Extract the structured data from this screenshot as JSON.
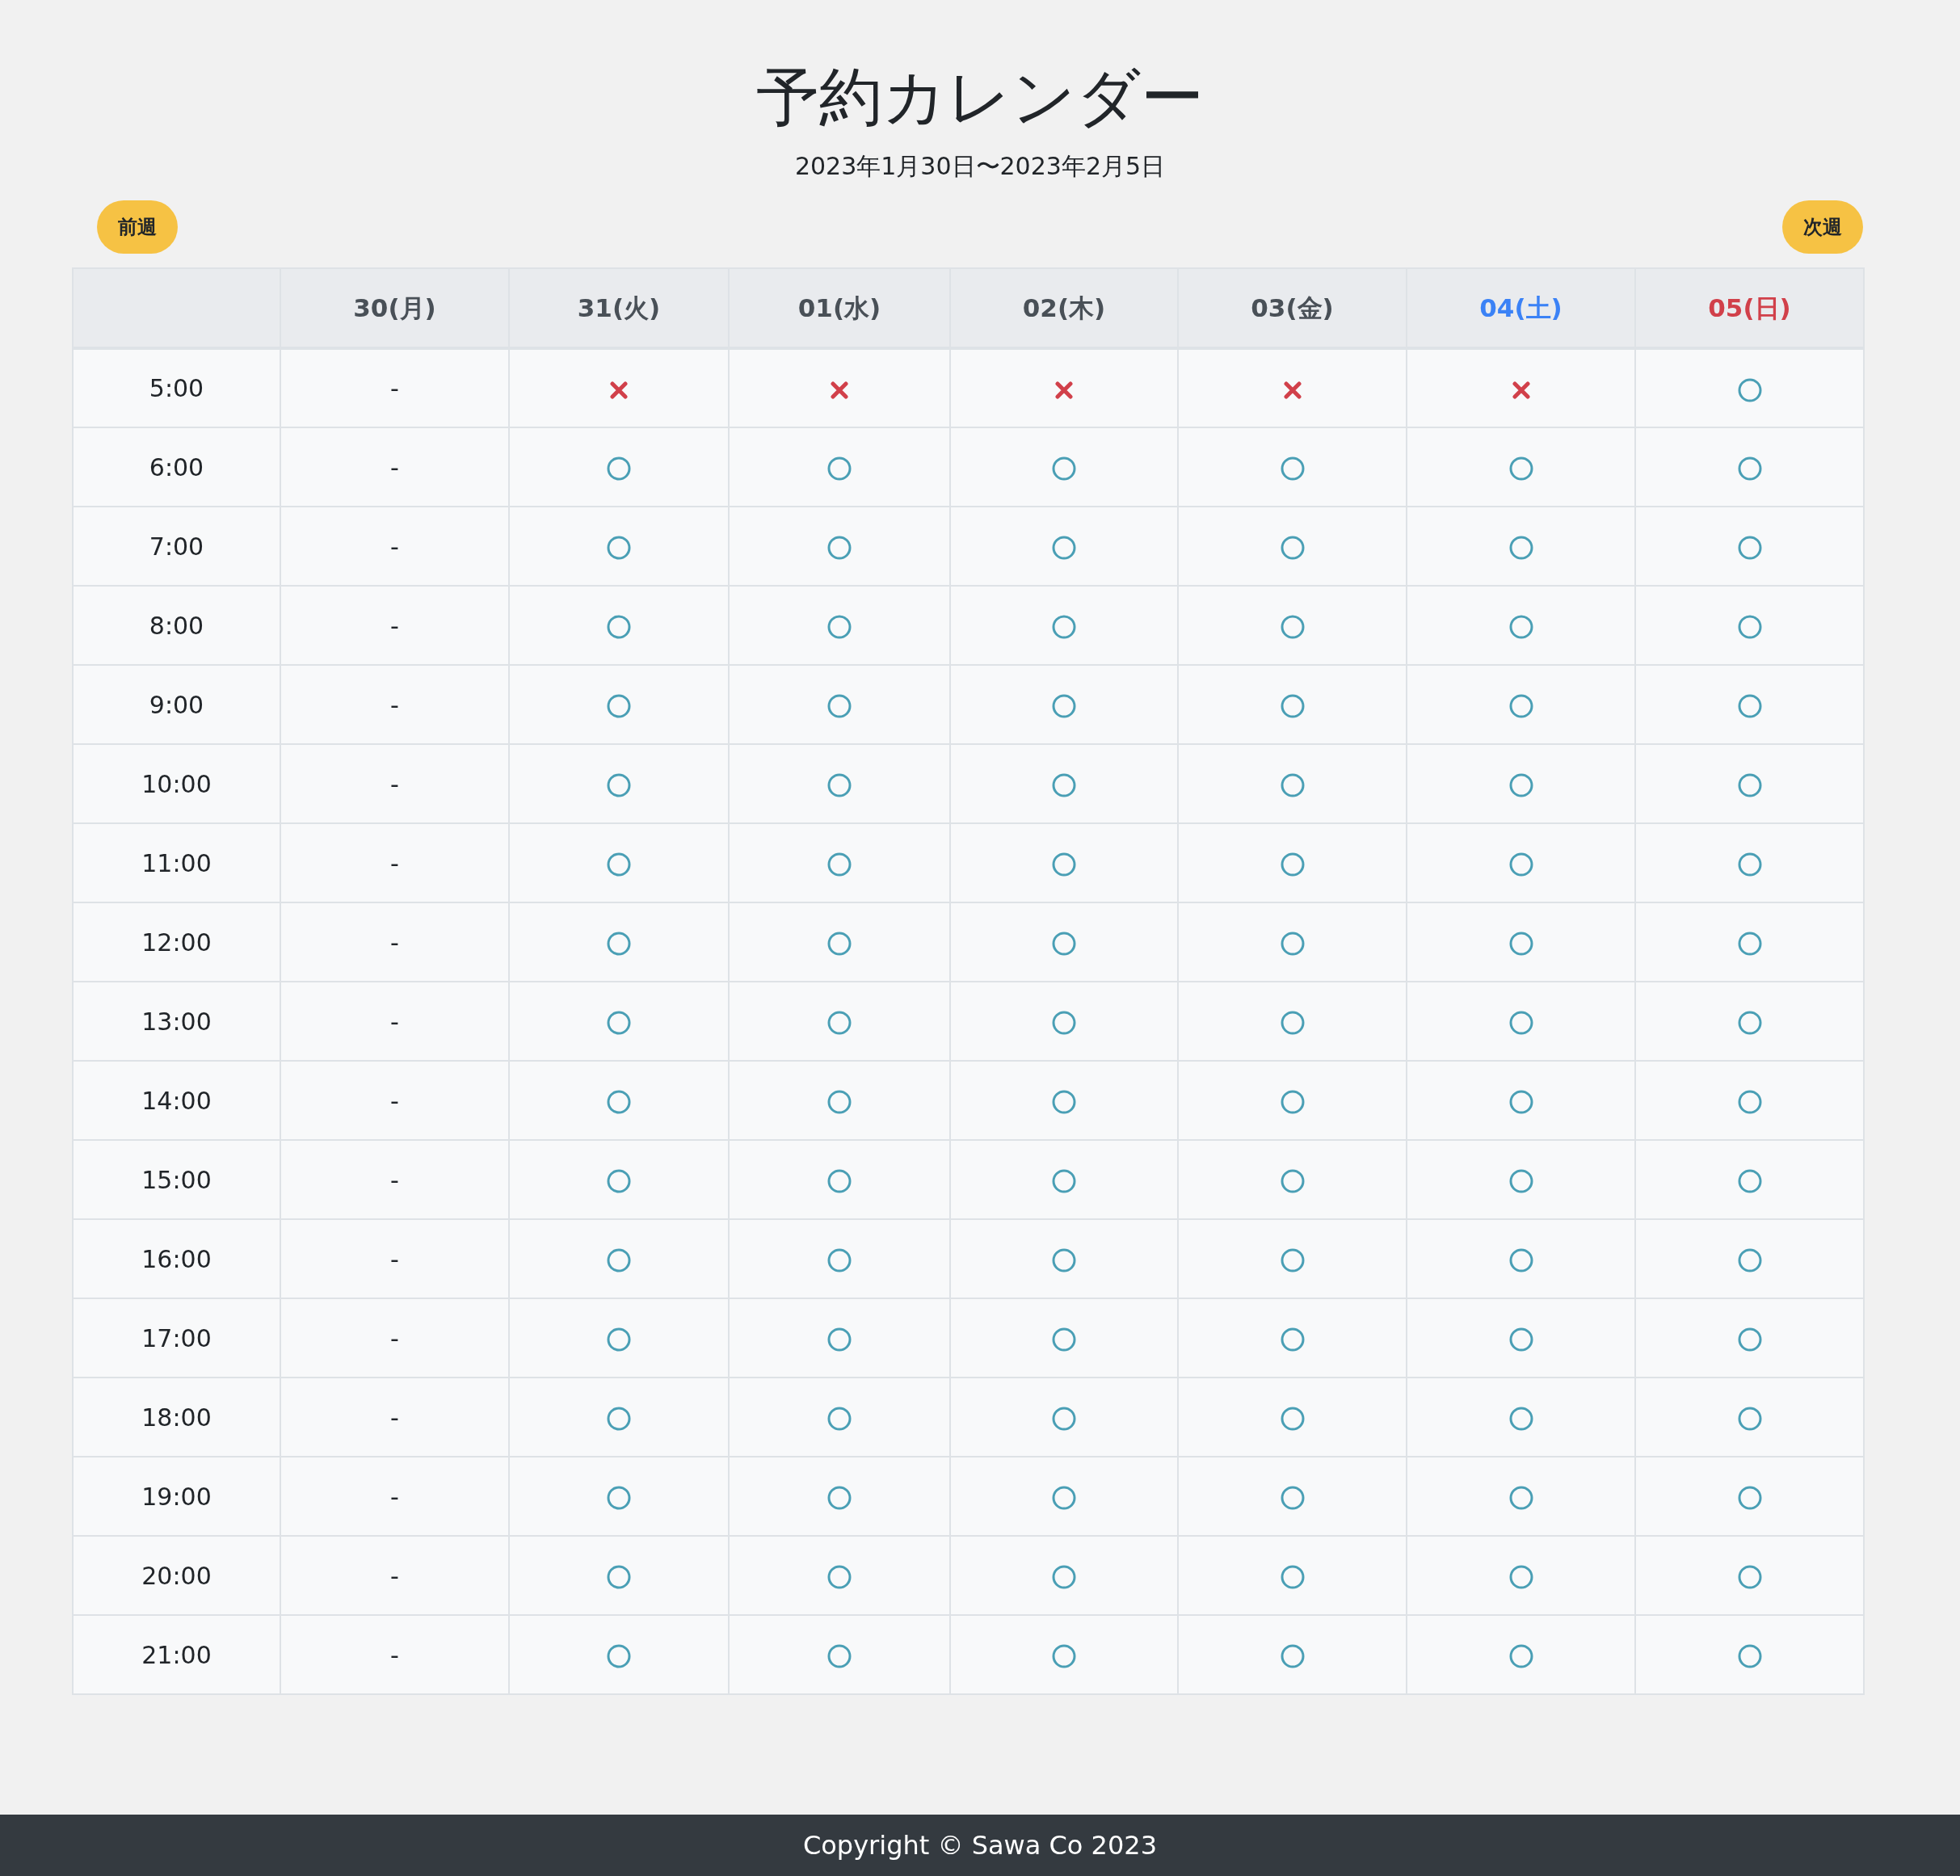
{
  "title": "予約カレンダー",
  "range": "2023年1月30日〜2023年2月5日",
  "nav": {
    "prev": "前週",
    "next": "次週"
  },
  "days": [
    {
      "label": "30(月)",
      "color": "#495057"
    },
    {
      "label": "31(火)",
      "color": "#495057"
    },
    {
      "label": "01(水)",
      "color": "#495057"
    },
    {
      "label": "02(木)",
      "color": "#495057"
    },
    {
      "label": "03(金)",
      "color": "#495057"
    },
    {
      "label": "04(土)",
      "color": "#3b82f6"
    },
    {
      "label": "05(日)",
      "color": "#d1404a"
    }
  ],
  "rows": [
    {
      "time": "5:00",
      "slots": [
        {
          "kind": "closed",
          "text": "-"
        },
        {
          "kind": "full"
        },
        {
          "kind": "full"
        },
        {
          "kind": "full"
        },
        {
          "kind": "full"
        },
        {
          "kind": "full"
        },
        {
          "kind": "open"
        }
      ]
    },
    {
      "time": "6:00",
      "slots": [
        {
          "kind": "closed",
          "text": "-"
        },
        {
          "kind": "open"
        },
        {
          "kind": "open"
        },
        {
          "kind": "open"
        },
        {
          "kind": "open"
        },
        {
          "kind": "open"
        },
        {
          "kind": "open"
        }
      ]
    },
    {
      "time": "7:00",
      "slots": [
        {
          "kind": "closed",
          "text": "-"
        },
        {
          "kind": "open"
        },
        {
          "kind": "open"
        },
        {
          "kind": "open"
        },
        {
          "kind": "open"
        },
        {
          "kind": "open"
        },
        {
          "kind": "open"
        }
      ]
    },
    {
      "time": "8:00",
      "slots": [
        {
          "kind": "closed",
          "text": "-"
        },
        {
          "kind": "open"
        },
        {
          "kind": "open"
        },
        {
          "kind": "open"
        },
        {
          "kind": "open"
        },
        {
          "kind": "open"
        },
        {
          "kind": "open"
        }
      ]
    },
    {
      "time": "9:00",
      "slots": [
        {
          "kind": "closed",
          "text": "-"
        },
        {
          "kind": "open"
        },
        {
          "kind": "open"
        },
        {
          "kind": "open"
        },
        {
          "kind": "open"
        },
        {
          "kind": "open"
        },
        {
          "kind": "open"
        }
      ]
    },
    {
      "time": "10:00",
      "slots": [
        {
          "kind": "closed",
          "text": "-"
        },
        {
          "kind": "open"
        },
        {
          "kind": "open"
        },
        {
          "kind": "open"
        },
        {
          "kind": "open"
        },
        {
          "kind": "open"
        },
        {
          "kind": "open"
        }
      ]
    },
    {
      "time": "11:00",
      "slots": [
        {
          "kind": "closed",
          "text": "-"
        },
        {
          "kind": "open"
        },
        {
          "kind": "open"
        },
        {
          "kind": "open"
        },
        {
          "kind": "open"
        },
        {
          "kind": "open"
        },
        {
          "kind": "open"
        }
      ]
    },
    {
      "time": "12:00",
      "slots": [
        {
          "kind": "closed",
          "text": "-"
        },
        {
          "kind": "open"
        },
        {
          "kind": "open"
        },
        {
          "kind": "open"
        },
        {
          "kind": "open"
        },
        {
          "kind": "open"
        },
        {
          "kind": "open"
        }
      ]
    },
    {
      "time": "13:00",
      "slots": [
        {
          "kind": "closed",
          "text": "-"
        },
        {
          "kind": "open"
        },
        {
          "kind": "open"
        },
        {
          "kind": "open"
        },
        {
          "kind": "open"
        },
        {
          "kind": "open"
        },
        {
          "kind": "open"
        }
      ]
    },
    {
      "time": "14:00",
      "slots": [
        {
          "kind": "closed",
          "text": "-"
        },
        {
          "kind": "open"
        },
        {
          "kind": "open"
        },
        {
          "kind": "open"
        },
        {
          "kind": "open"
        },
        {
          "kind": "open"
        },
        {
          "kind": "open"
        }
      ]
    },
    {
      "time": "15:00",
      "slots": [
        {
          "kind": "closed",
          "text": "-"
        },
        {
          "kind": "open"
        },
        {
          "kind": "open"
        },
        {
          "kind": "open"
        },
        {
          "kind": "open"
        },
        {
          "kind": "open"
        },
        {
          "kind": "open"
        }
      ]
    },
    {
      "time": "16:00",
      "slots": [
        {
          "kind": "closed",
          "text": "-"
        },
        {
          "kind": "open"
        },
        {
          "kind": "open"
        },
        {
          "kind": "open"
        },
        {
          "kind": "open"
        },
        {
          "kind": "open"
        },
        {
          "kind": "open"
        }
      ]
    },
    {
      "time": "17:00",
      "slots": [
        {
          "kind": "closed",
          "text": "-"
        },
        {
          "kind": "open"
        },
        {
          "kind": "open"
        },
        {
          "kind": "open"
        },
        {
          "kind": "open"
        },
        {
          "kind": "open"
        },
        {
          "kind": "open"
        }
      ]
    },
    {
      "time": "18:00",
      "slots": [
        {
          "kind": "closed",
          "text": "-"
        },
        {
          "kind": "open"
        },
        {
          "kind": "open"
        },
        {
          "kind": "open"
        },
        {
          "kind": "open"
        },
        {
          "kind": "open"
        },
        {
          "kind": "open"
        }
      ]
    },
    {
      "time": "19:00",
      "slots": [
        {
          "kind": "closed",
          "text": "-"
        },
        {
          "kind": "open"
        },
        {
          "kind": "open"
        },
        {
          "kind": "open"
        },
        {
          "kind": "open"
        },
        {
          "kind": "open"
        },
        {
          "kind": "open"
        }
      ]
    },
    {
      "time": "20:00",
      "slots": [
        {
          "kind": "closed",
          "text": "-"
        },
        {
          "kind": "open"
        },
        {
          "kind": "open"
        },
        {
          "kind": "open"
        },
        {
          "kind": "open"
        },
        {
          "kind": "open"
        },
        {
          "kind": "open"
        }
      ]
    },
    {
      "time": "21:00",
      "slots": [
        {
          "kind": "closed",
          "text": "-"
        },
        {
          "kind": "open"
        },
        {
          "kind": "open"
        },
        {
          "kind": "open"
        },
        {
          "kind": "open"
        },
        {
          "kind": "open"
        },
        {
          "kind": "open"
        }
      ]
    }
  ],
  "footer": "Copyright © Sawa Co 2023"
}
